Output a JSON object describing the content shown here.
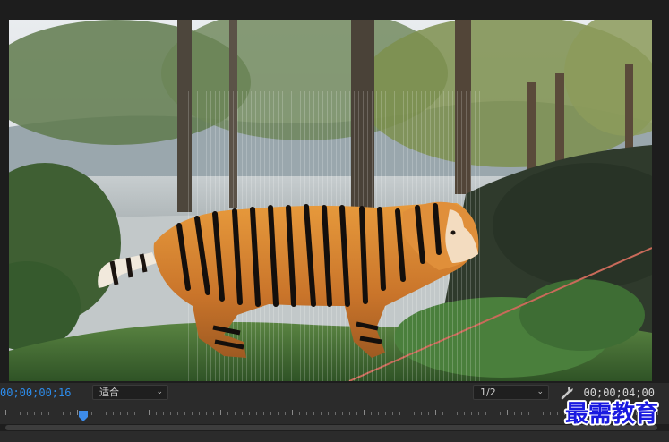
{
  "monitor": {
    "current_time": "00;00;00;16",
    "duration": "00;00;04;00",
    "fit_dropdown": {
      "selected": "适合"
    },
    "resolution_dropdown": {
      "selected": "1/2"
    },
    "chevron": "⌄"
  },
  "watermark": {
    "text": "最需教育"
  },
  "icons": {
    "settings": "wrench-icon",
    "playhead": "playhead-marker-icon",
    "dropdown": "chevron-down-icon"
  },
  "colors": {
    "accent_timecode": "#2d8ceb",
    "panel_bg": "#2b2b2b",
    "watermark_text": "#1a1ae0"
  }
}
